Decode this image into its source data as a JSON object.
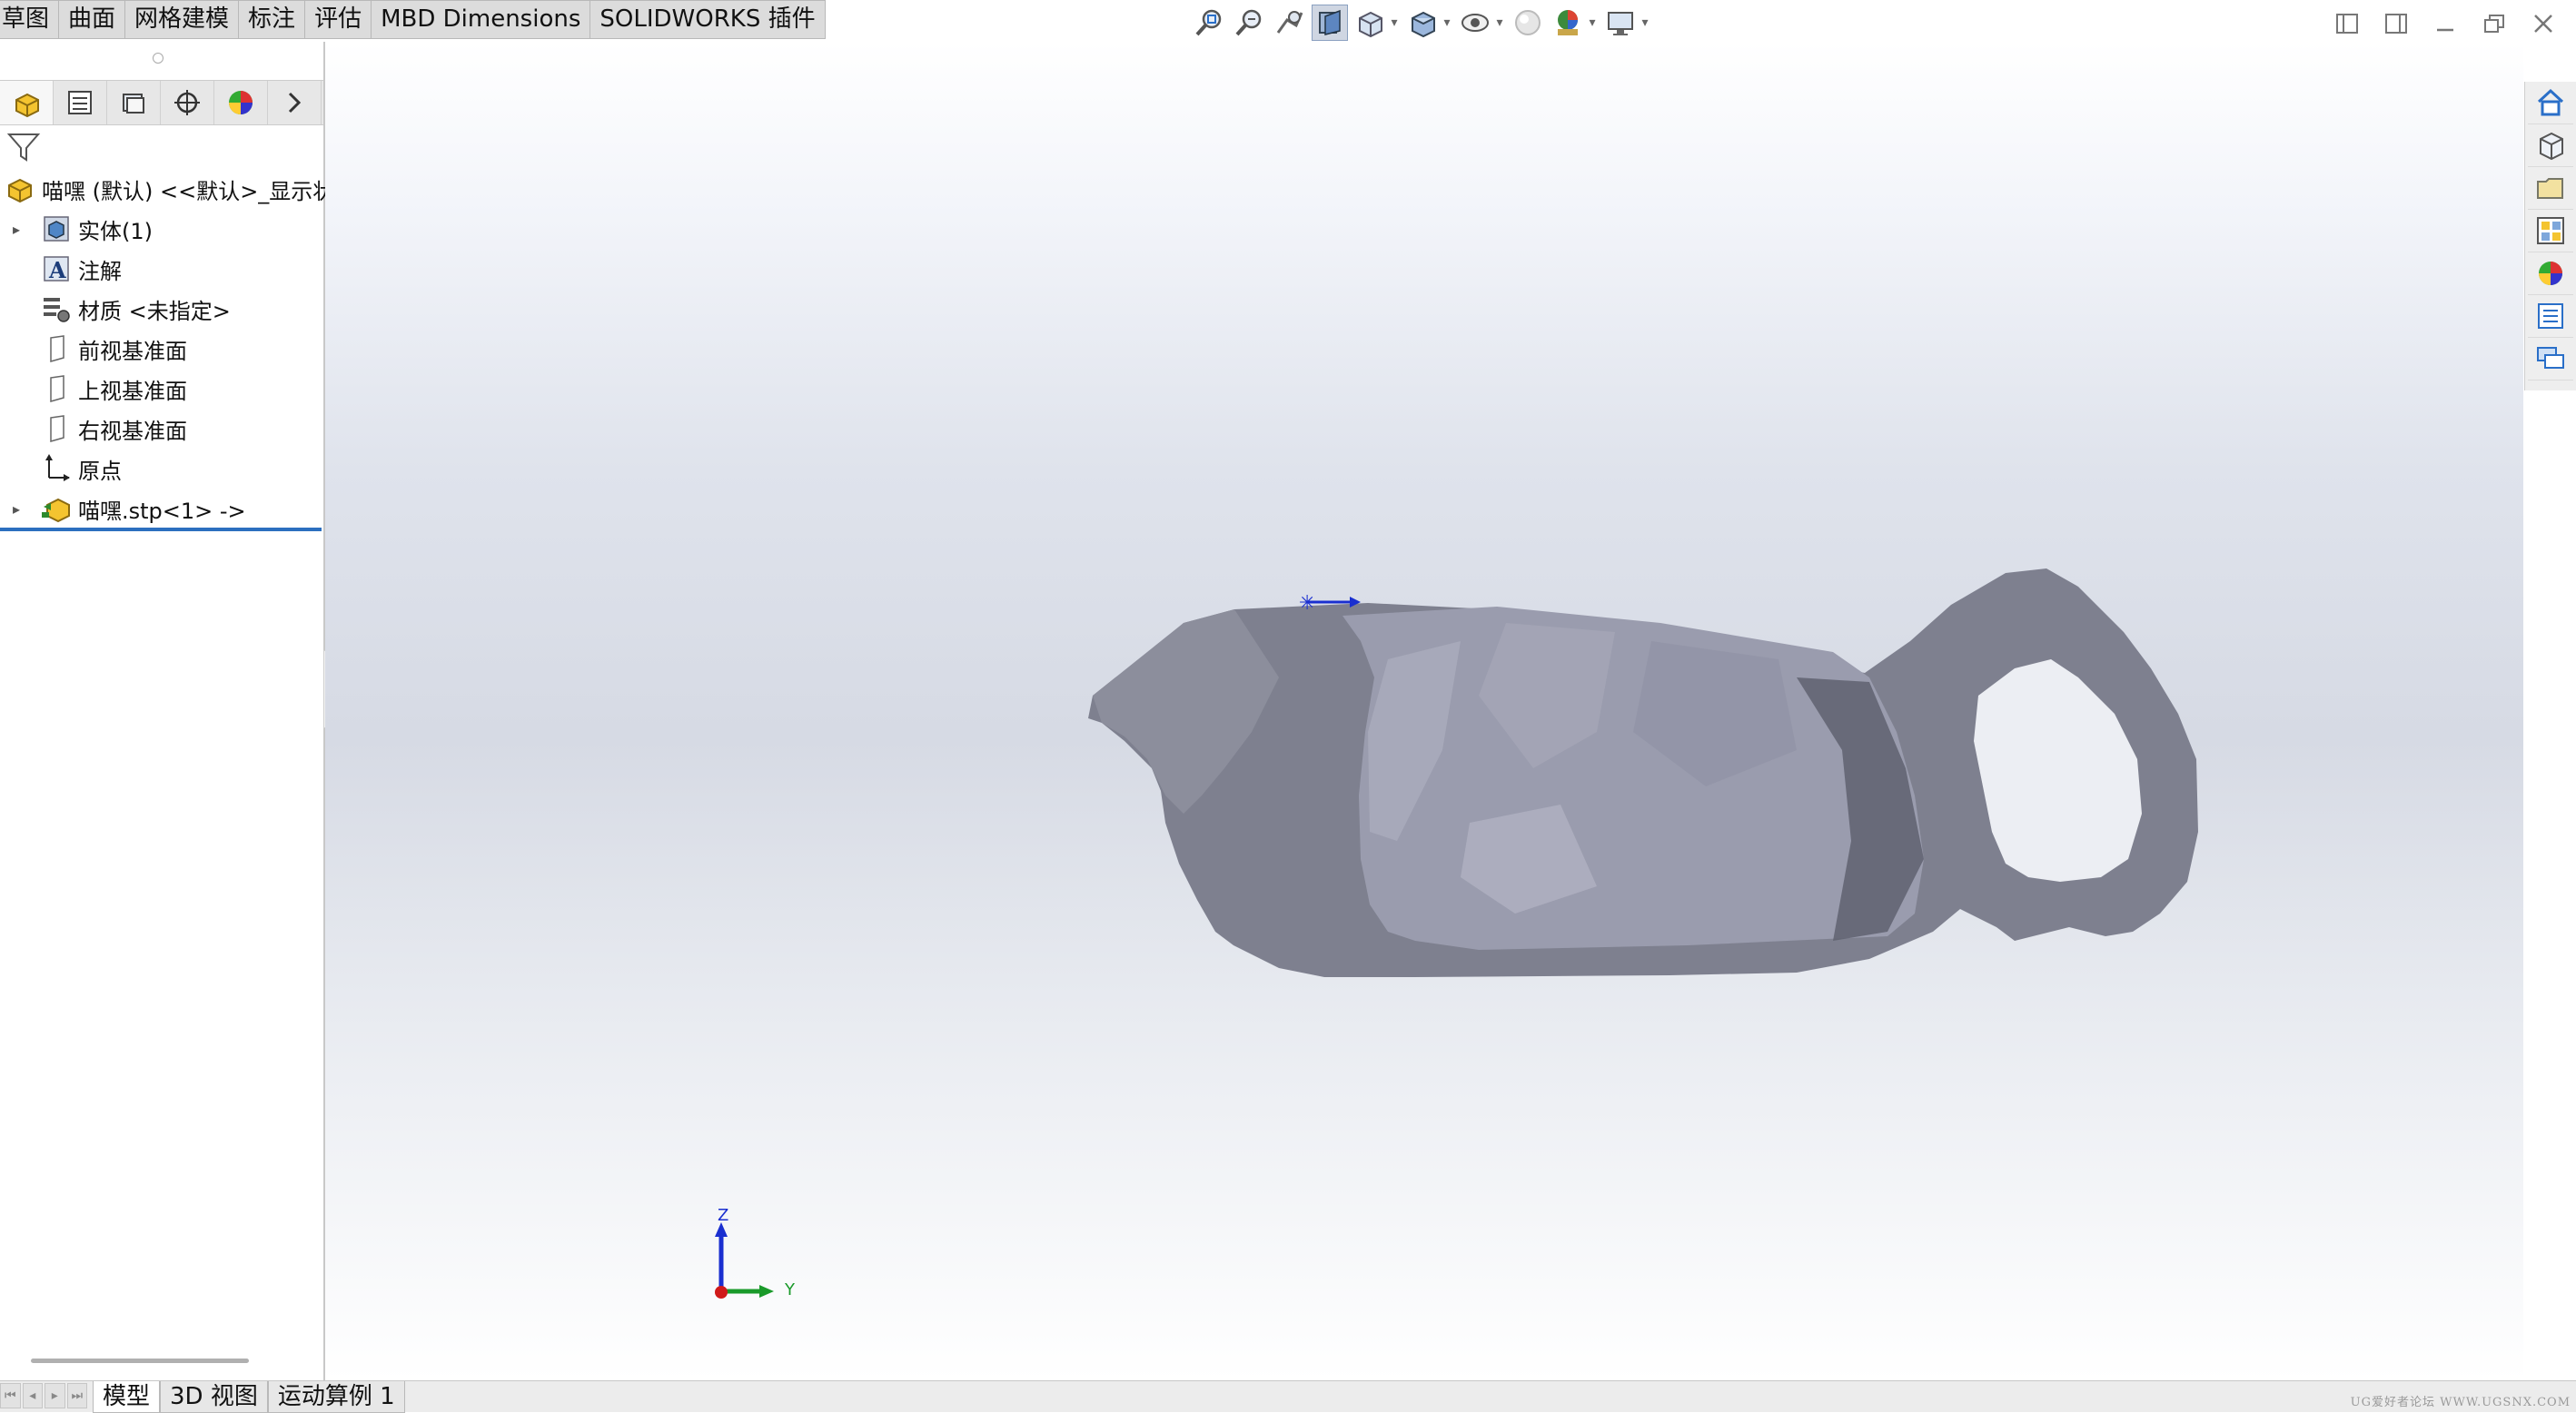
{
  "ribbon": {
    "tabs": [
      "草图",
      "曲面",
      "网格建模",
      "标注",
      "评估",
      "MBD Dimensions",
      "SOLIDWORKS 插件"
    ]
  },
  "hud_toolbar": {
    "icons": [
      "zoom-to-fit-icon",
      "zoom-to-area-icon",
      "previous-view-icon",
      "section-view-icon",
      "view-orientation-icon",
      "display-style-icon",
      "hide-show-items-icon",
      "edit-appearance-icon",
      "apply-scene-icon",
      "view-settings-icon"
    ]
  },
  "feature_tree": {
    "root": "喵嘿 (默认) <<默认>_显示状",
    "items": [
      {
        "label": "实体(1)",
        "icon": "solid-bodies-icon",
        "expandable": true
      },
      {
        "label": "注解",
        "icon": "annotations-icon",
        "expandable": false
      },
      {
        "label": "材质 <未指定>",
        "icon": "material-icon",
        "expandable": false
      },
      {
        "label": "前视基准面",
        "icon": "plane-icon",
        "expandable": false
      },
      {
        "label": "上视基准面",
        "icon": "plane-icon",
        "expandable": false
      },
      {
        "label": "右视基准面",
        "icon": "plane-icon",
        "expandable": false
      },
      {
        "label": "原点",
        "icon": "origin-icon",
        "expandable": false
      },
      {
        "label": "喵嘿.stp<1> ->",
        "icon": "imported-part-icon",
        "expandable": true
      }
    ]
  },
  "triad": {
    "z": "Z",
    "y": "Y"
  },
  "colors": {
    "model_fill": "#7e808f",
    "model_inner": "#9a9cae",
    "tree_underline": "#2c6fbf",
    "axis_z": "#1a2fd0",
    "axis_y": "#1a9a2a",
    "axis_x": "#d01a1a"
  },
  "bottom_tabs": [
    "模型",
    "3D 视图",
    "运动算例 1"
  ],
  "watermark": "UG爱好者论坛 WWW.UGSNX.COM"
}
